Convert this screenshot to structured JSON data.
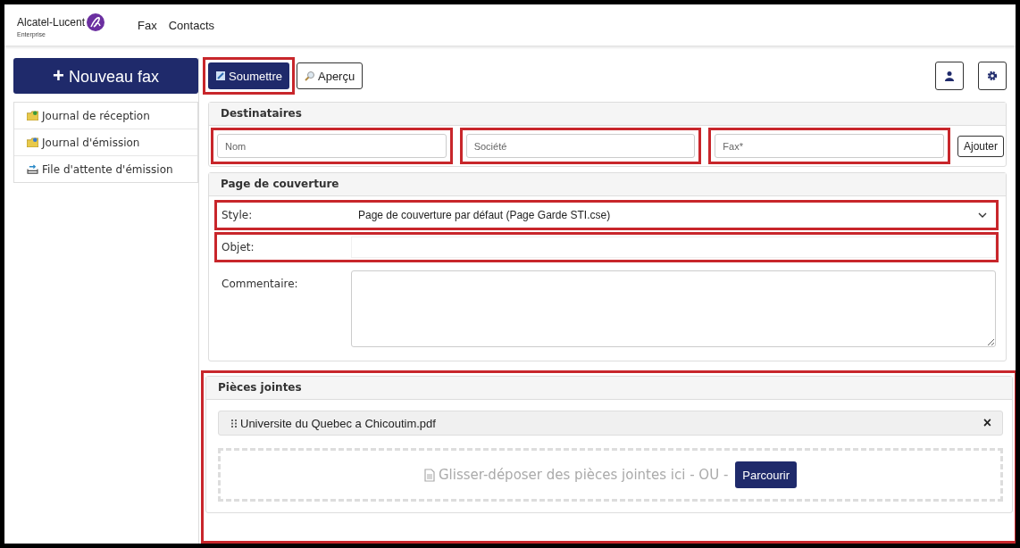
{
  "brand": {
    "name": "Alcatel-Lucent",
    "sub": "Enterprise"
  },
  "nav": [
    "Fax",
    "Contacts"
  ],
  "new_fax": {
    "icon": "+",
    "label": "Nouveau fax"
  },
  "sidebar": {
    "items": [
      {
        "label": "Journal de réception",
        "kind": "inbox"
      },
      {
        "label": "Journal d'émission",
        "kind": "outbox"
      },
      {
        "label": "File d'attente d'émission",
        "kind": "queue"
      }
    ]
  },
  "toolbar": {
    "submit": {
      "label": "Soumettre",
      "highlighted": true
    },
    "preview": {
      "label": "Aperçu"
    }
  },
  "recipients": {
    "title": "Destinataires",
    "fields": [
      {
        "placeholder": "Nom",
        "highlighted": true
      },
      {
        "placeholder": "Société",
        "highlighted": true
      },
      {
        "placeholder": "Fax*",
        "highlighted": true
      }
    ],
    "add": "Ajouter"
  },
  "cover": {
    "title": "Page de couverture",
    "style": {
      "label": "Style:",
      "value": "Page de couverture par défaut (Page Garde STI.cse)",
      "highlighted": true
    },
    "subject": {
      "label": "Objet:",
      "highlighted": true
    },
    "comment": {
      "label": "Commentaire:"
    }
  },
  "attachments": {
    "title": "Pièces jointes",
    "highlighted": true,
    "files": [
      {
        "name": "Universite du Quebec a Chicoutim.pdf",
        "remove": "×"
      }
    ],
    "drop_text": "Glisser-déposer des pièces jointes ici - OU -",
    "browse": "Parcourir"
  }
}
